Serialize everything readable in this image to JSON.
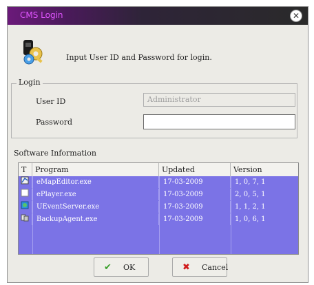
{
  "window": {
    "title": "CMS Login"
  },
  "header": {
    "message": "Input User ID and Password for login."
  },
  "login": {
    "group_title": "Login",
    "user_id_label": "User ID",
    "user_id_value": "Administrator",
    "password_label": "Password",
    "password_value": ""
  },
  "software": {
    "section_title": "Software Information",
    "columns": [
      "T",
      "Program",
      "Updated",
      "Version"
    ],
    "rows": [
      {
        "icon": "map-icon",
        "program": "eMapEditor.exe",
        "updated": "17-03-2009",
        "version": "1, 0, 7, 1"
      },
      {
        "icon": "player-icon",
        "program": "ePlayer.exe",
        "updated": "17-03-2009",
        "version": "2, 0, 5, 1"
      },
      {
        "icon": "server-icon",
        "program": "UEventServer.exe",
        "updated": "17-03-2009",
        "version": "1, 1, 2, 1"
      },
      {
        "icon": "backup-icon",
        "program": "BackupAgent.exe",
        "updated": "17-03-2009",
        "version": "1, 0, 6, 1"
      }
    ]
  },
  "buttons": {
    "ok_label": "OK",
    "cancel_label": "Cancel"
  },
  "colors": {
    "selection": "#7b73e6",
    "title_text": "#e055ff",
    "ok_check": "#3aa02a",
    "cancel_x": "#d01c1c"
  }
}
